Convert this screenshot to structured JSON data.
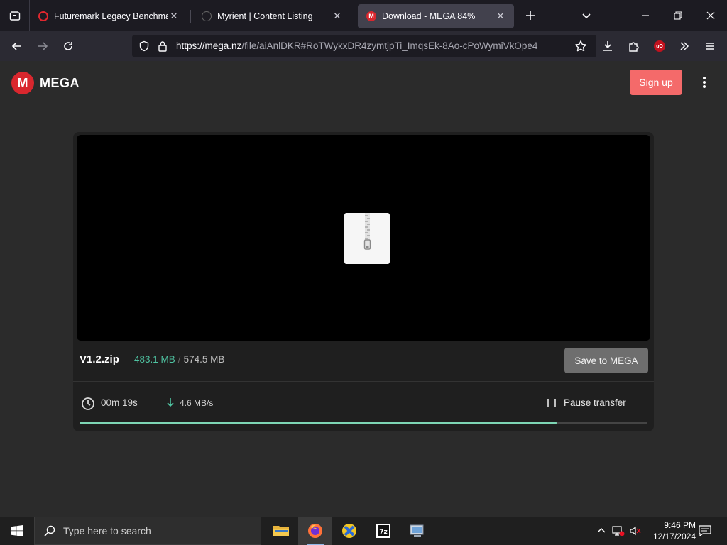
{
  "browser": {
    "tabs": [
      {
        "label": "Futuremark Legacy Benchmark",
        "favicon_color": "#e0272e"
      },
      {
        "label": "Myrient | Content Listing",
        "favicon_color": "#444444"
      },
      {
        "label": "Download - MEGA 84%",
        "favicon_color": "#d9272e",
        "active": true
      }
    ],
    "url_host": "https://mega.nz",
    "url_path": "/file/aiAnlDKR#RoTWykxDR4zymtjpTi_ImqsEk-8Ao-cPoWymiVkOpe4",
    "extension_badge": "uO"
  },
  "page": {
    "logo_letter": "M",
    "logo_text": "MEGA",
    "signup_label": "Sign up"
  },
  "download": {
    "file_name": "V1.2.zip",
    "downloaded": "483.1 MB",
    "separator": "/",
    "total": "574.5 MB",
    "save_label": "Save to MEGA",
    "eta": "00m 19s",
    "speed": "4.6 MB/s",
    "pause_label": "Pause transfer",
    "progress_fraction": 0.84
  },
  "taskbar": {
    "search_placeholder": "Type here to search",
    "time": "9:46 PM",
    "date": "12/17/2024"
  },
  "colors": {
    "brand": "#d9272e",
    "signup": "#f46a6a",
    "progress": "#7ed6b5",
    "downloaded_text": "#4fc3a1"
  }
}
